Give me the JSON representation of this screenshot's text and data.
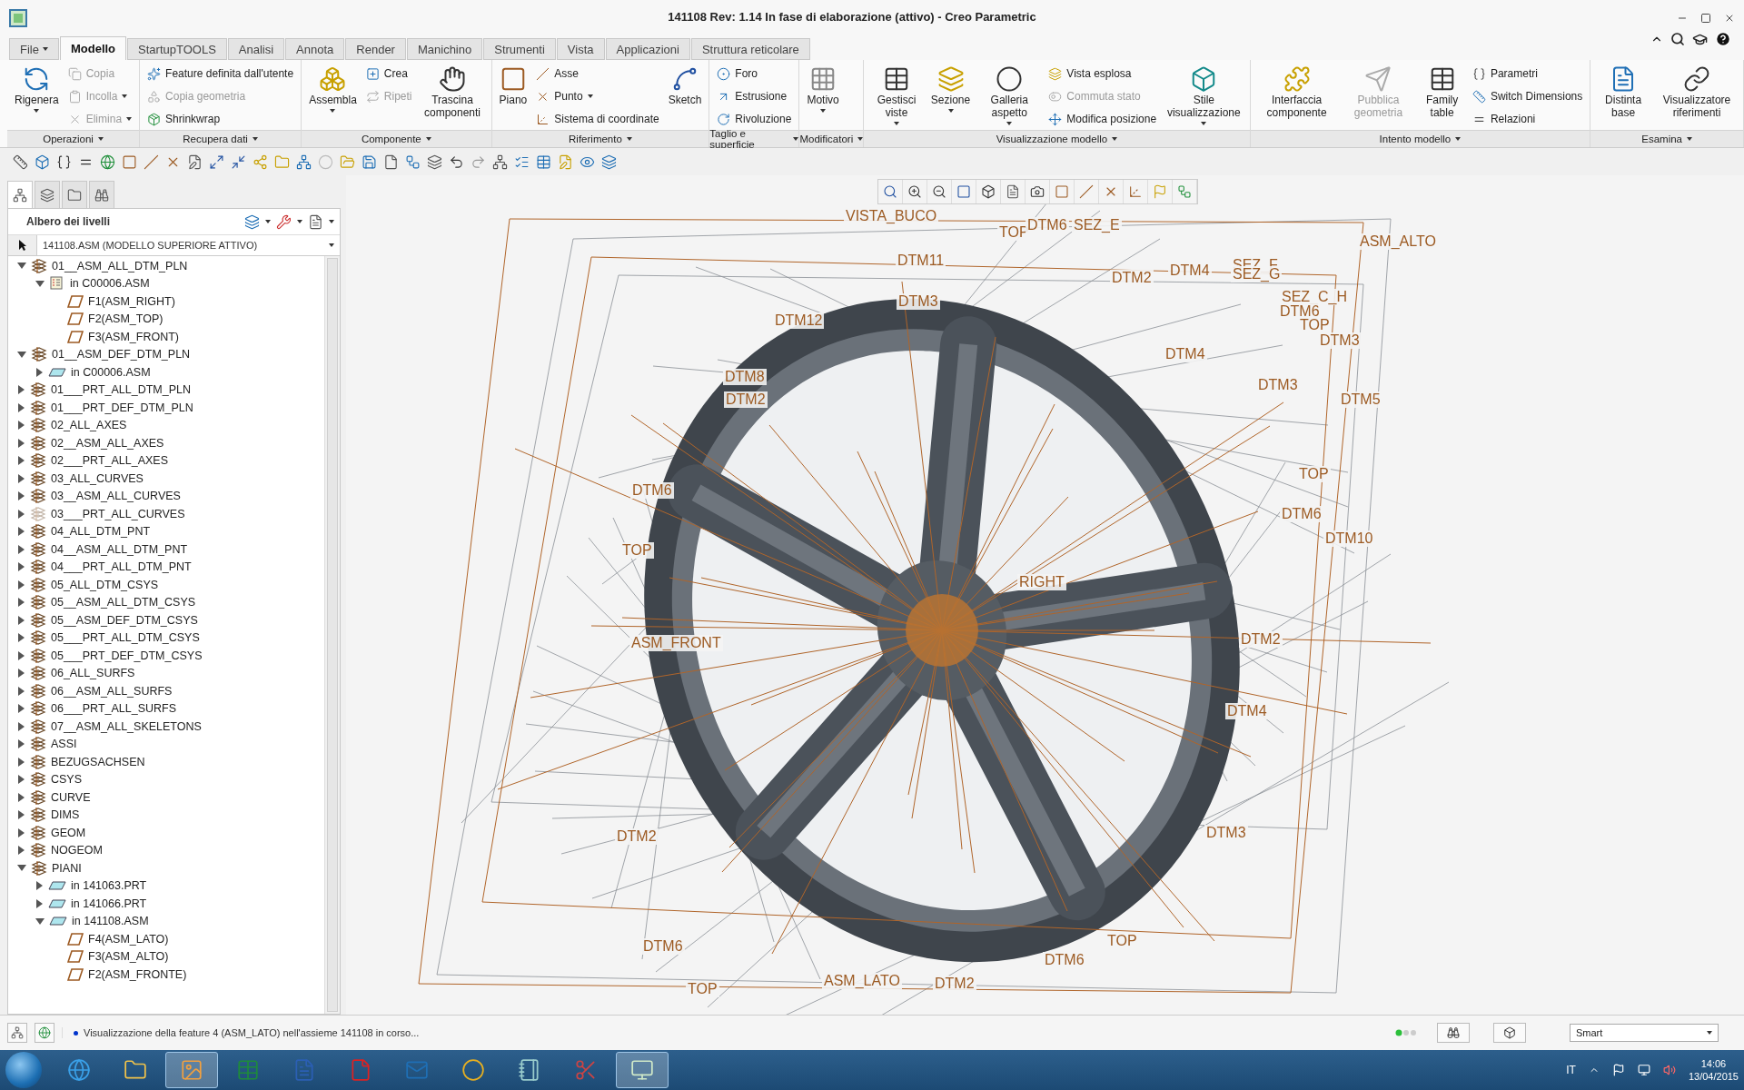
{
  "window": {
    "title": "141108 Rev: 1.14 In fase di elaborazione  (attivo) - Creo Parametric"
  },
  "tabs": [
    {
      "label": "File",
      "selected": false,
      "dropdown": true
    },
    {
      "label": "Modello",
      "selected": true,
      "dropdown": false
    },
    {
      "label": "StartupTOOLS",
      "selected": false,
      "dropdown": false
    },
    {
      "label": "Analisi",
      "selected": false,
      "dropdown": false
    },
    {
      "label": "Annota",
      "selected": false,
      "dropdown": false
    },
    {
      "label": "Render",
      "selected": false,
      "dropdown": false
    },
    {
      "label": "Manichino",
      "selected": false,
      "dropdown": false
    },
    {
      "label": "Strumenti",
      "selected": false,
      "dropdown": false
    },
    {
      "label": "Vista",
      "selected": false,
      "dropdown": false
    },
    {
      "label": "Applicazioni",
      "selected": false,
      "dropdown": false
    },
    {
      "label": "Struttura reticolare",
      "selected": false,
      "dropdown": false
    }
  ],
  "ribbon": {
    "groups": [
      {
        "label": "Operazioni",
        "items": [
          {
            "kind": "large",
            "label": "Rigenera",
            "dropdown": true,
            "disabled": false
          },
          {
            "kind": "small",
            "label": "Copia",
            "dropdown": false,
            "disabled": true
          },
          {
            "kind": "small",
            "label": "Incolla",
            "dropdown": true,
            "disabled": true
          },
          {
            "kind": "small",
            "label": "Elimina",
            "dropdown": true,
            "disabled": true
          }
        ]
      },
      {
        "label": "Recupera dati",
        "items": [
          {
            "kind": "small",
            "label": "Feature definita dall'utente",
            "dropdown": false,
            "disabled": false
          },
          {
            "kind": "small",
            "label": "Copia geometria",
            "dropdown": false,
            "disabled": true
          },
          {
            "kind": "small",
            "label": "Shrinkwrap",
            "dropdown": false,
            "disabled": false
          }
        ]
      },
      {
        "label": "Componente",
        "items": [
          {
            "kind": "large",
            "label": "Assembla",
            "dropdown": true,
            "disabled": false
          },
          {
            "kind": "small",
            "label": "Crea",
            "dropdown": false,
            "disabled": false
          },
          {
            "kind": "small",
            "label": "Ripeti",
            "dropdown": false,
            "disabled": true
          },
          {
            "kind": "large",
            "label": "Trascina componenti",
            "dropdown": false,
            "disabled": false
          }
        ]
      },
      {
        "label": "Riferimento",
        "items": [
          {
            "kind": "large",
            "label": "Piano",
            "dropdown": false,
            "disabled": false
          },
          {
            "kind": "small",
            "label": "Asse",
            "dropdown": false,
            "disabled": false
          },
          {
            "kind": "small",
            "label": "Punto",
            "dropdown": true,
            "disabled": false
          },
          {
            "kind": "small",
            "label": "Sistema di coordinate",
            "dropdown": false,
            "disabled": false
          },
          {
            "kind": "large",
            "label": "Sketch",
            "dropdown": false,
            "disabled": false
          }
        ]
      },
      {
        "label": "Taglio e superficie",
        "items": [
          {
            "kind": "small",
            "label": "Foro",
            "dropdown": false,
            "disabled": false
          },
          {
            "kind": "small",
            "label": "Estrusione",
            "dropdown": false,
            "disabled": false
          },
          {
            "kind": "small",
            "label": "Rivoluzione",
            "dropdown": false,
            "disabled": false
          }
        ]
      },
      {
        "label": "Modificatori",
        "items": [
          {
            "kind": "large",
            "label": "Motivo",
            "dropdown": true,
            "disabled": false
          }
        ]
      },
      {
        "label": "Visualizzazione modello",
        "items": [
          {
            "kind": "large",
            "label": "Gestisci viste",
            "dropdown": true,
            "disabled": false
          },
          {
            "kind": "large",
            "label": "Sezione",
            "dropdown": true,
            "disabled": false
          },
          {
            "kind": "large",
            "label": "Galleria aspetto",
            "dropdown": true,
            "disabled": false
          },
          {
            "kind": "small",
            "label": "Vista esplosa",
            "dropdown": false,
            "disabled": false
          },
          {
            "kind": "small",
            "label": "Commuta stato",
            "dropdown": false,
            "disabled": true
          },
          {
            "kind": "small",
            "label": "Modifica posizione",
            "dropdown": false,
            "disabled": false
          },
          {
            "kind": "large",
            "label": "Stile visualizzazione",
            "dropdown": true,
            "disabled": false
          }
        ]
      },
      {
        "label": "Intento modello",
        "items": [
          {
            "kind": "large",
            "label": "Interfaccia componente",
            "dropdown": false,
            "disabled": false
          },
          {
            "kind": "large",
            "label": "Pubblica geometria",
            "dropdown": false,
            "disabled": true
          },
          {
            "kind": "large",
            "label": "Family table",
            "dropdown": false,
            "disabled": false
          },
          {
            "kind": "small",
            "label": "Parametri",
            "dropdown": false,
            "disabled": false
          },
          {
            "kind": "small",
            "label": "Switch Dimensions",
            "dropdown": false,
            "disabled": false
          },
          {
            "kind": "small",
            "label": "Relazioni",
            "dropdown": false,
            "disabled": false
          }
        ]
      },
      {
        "label": "Esamina",
        "items": [
          {
            "kind": "large",
            "label": "Distinta base",
            "dropdown": false,
            "disabled": false
          },
          {
            "kind": "large",
            "label": "Visualizzatore riferimenti",
            "dropdown": false,
            "disabled": false
          }
        ]
      }
    ]
  },
  "panel_tabs": [
    {
      "selected": true
    },
    {
      "selected": false
    },
    {
      "selected": false
    },
    {
      "selected": false
    }
  ],
  "layer_tree": {
    "title": "Albero dei livelli",
    "model": "141108.ASM (MODELLO SUPERIORE ATTIVO)",
    "items": [
      {
        "label": "01__ASM_ALL_DTM_PLN",
        "kind": "layer",
        "expanded": true,
        "children": [
          {
            "label": "in C00006.ASM",
            "kind": "model",
            "expanded": true,
            "children": [
              {
                "label": "F1(ASM_RIGHT)",
                "kind": "feature"
              },
              {
                "label": "F2(ASM_TOP)",
                "kind": "feature"
              },
              {
                "label": "F3(ASM_FRONT)",
                "kind": "feature"
              }
            ]
          }
        ]
      },
      {
        "label": "01__ASM_DEF_DTM_PLN",
        "kind": "layer",
        "expanded": true,
        "children": [
          {
            "label": "in C00006.ASM",
            "kind": "plane",
            "expanded": false
          }
        ]
      },
      {
        "label": "01___PRT_ALL_DTM_PLN",
        "kind": "layer",
        "expanded": false
      },
      {
        "label": "01___PRT_DEF_DTM_PLN",
        "kind": "layer",
        "expanded": false
      },
      {
        "label": "02_ALL_AXES",
        "kind": "layer",
        "expanded": false
      },
      {
        "label": "02__ASM_ALL_AXES",
        "kind": "layer",
        "expanded": false
      },
      {
        "label": "02___PRT_ALL_AXES",
        "kind": "layer",
        "expanded": false
      },
      {
        "label": "03_ALL_CURVES",
        "kind": "layer",
        "expanded": false
      },
      {
        "label": "03__ASM_ALL_CURVES",
        "kind": "layer",
        "expanded": false
      },
      {
        "label": "03___PRT_ALL_CURVES",
        "kind": "faded-layer",
        "expanded": false
      },
      {
        "label": "04_ALL_DTM_PNT",
        "kind": "layer",
        "expanded": false
      },
      {
        "label": "04__ASM_ALL_DTM_PNT",
        "kind": "layer",
        "expanded": false
      },
      {
        "label": "04___PRT_ALL_DTM_PNT",
        "kind": "layer",
        "expanded": false
      },
      {
        "label": "05_ALL_DTM_CSYS",
        "kind": "layer",
        "expanded": false
      },
      {
        "label": "05__ASM_ALL_DTM_CSYS",
        "kind": "layer",
        "expanded": false
      },
      {
        "label": "05__ASM_DEF_DTM_CSYS",
        "kind": "layer",
        "expanded": false
      },
      {
        "label": "05___PRT_ALL_DTM_CSYS",
        "kind": "layer",
        "expanded": false
      },
      {
        "label": "05___PRT_DEF_DTM_CSYS",
        "kind": "layer",
        "expanded": false
      },
      {
        "label": "06_ALL_SURFS",
        "kind": "layer",
        "expanded": false
      },
      {
        "label": "06__ASM_ALL_SURFS",
        "kind": "layer",
        "expanded": false
      },
      {
        "label": "06___PRT_ALL_SURFS",
        "kind": "layer",
        "expanded": false
      },
      {
        "label": "07__ASM_ALL_SKELETONS",
        "kind": "layer",
        "expanded": false
      },
      {
        "label": "ASSI",
        "kind": "layer",
        "expanded": false
      },
      {
        "label": "BEZUGSACHSEN",
        "kind": "layer",
        "expanded": false
      },
      {
        "label": "CSYS",
        "kind": "layer",
        "expanded": false
      },
      {
        "label": "CURVE",
        "kind": "layer",
        "expanded": false
      },
      {
        "label": "DIMS",
        "kind": "layer",
        "expanded": false
      },
      {
        "label": "GEOM",
        "kind": "layer",
        "expanded": false
      },
      {
        "label": "NOGEOM",
        "kind": "layer",
        "expanded": false
      },
      {
        "label": "PIANI",
        "kind": "layer",
        "expanded": true,
        "children": [
          {
            "label": "in 141063.PRT",
            "kind": "plane",
            "expanded": false
          },
          {
            "label": "in 141066.PRT",
            "kind": "plane",
            "expanded": false
          },
          {
            "label": "in 141108.ASM",
            "kind": "plane",
            "expanded": true,
            "children": [
              {
                "label": "F4(ASM_LATO)",
                "kind": "feature"
              },
              {
                "label": "F3(ASM_ALTO)",
                "kind": "feature"
              },
              {
                "label": "F2(ASM_FRONTE)",
                "kind": "feature"
              }
            ]
          }
        ]
      }
    ]
  },
  "viewport": {
    "labels": [
      "VISTA_BUCO",
      "TOP",
      "DTM6",
      "SEZ_E",
      "ASM_ALTO",
      "DTM11",
      "DTM2",
      "DTM4",
      "SEZ_F",
      "SEZ_G",
      "SEZ_C_H",
      "DTM3",
      "DTM6",
      "TOP",
      "DTM3",
      "DTM12",
      "DTM4",
      "DTM8",
      "DTM3",
      "DTM5",
      "DTM2",
      "DTM6",
      "TOP",
      "TOP",
      "DTM6",
      "DTM10",
      "RIGHT",
      "ASM_FRONT",
      "DTM2",
      "DTM4",
      "DTM2",
      "DTM3",
      "DTM6",
      "TOP",
      "DTM6",
      "TOP",
      "ASM_LATO",
      "DTM2"
    ]
  },
  "status_bar": {
    "message": "Visualizzazione della feature 4 (ASM_LATO) nell'assieme 141108 in corso...",
    "filter": "Smart"
  },
  "taskbar": {
    "language": "IT",
    "time": "14:06",
    "date": "13/04/2015"
  }
}
